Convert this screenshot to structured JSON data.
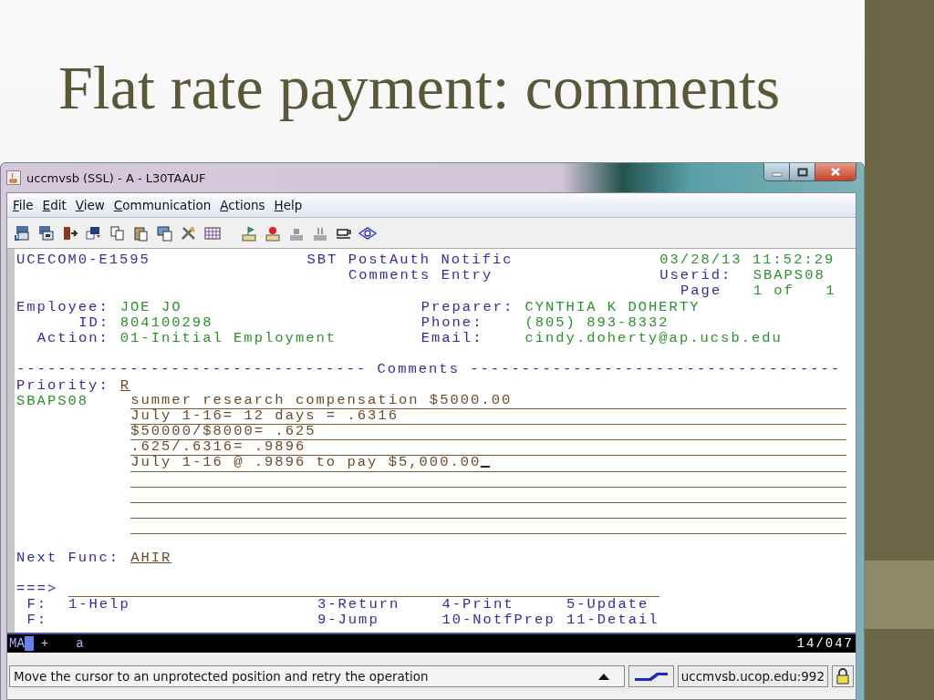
{
  "slide": {
    "title": "Flat rate payment: comments"
  },
  "window": {
    "title": "uccmvsb (SSL) - A - L30TAAUF"
  },
  "menu": [
    "File",
    "Edit",
    "View",
    "Communication",
    "Actions",
    "Help"
  ],
  "header": {
    "screen_id": "UCECOM0-E1595",
    "title_lines": [
      "SBT PostAuth Notific",
      "Comments Entry"
    ],
    "timestamp": "03/28/13 11:52:29",
    "userid_label": "Userid:",
    "userid": "SBAPS08",
    "page_label": "Page",
    "page_of": "1 of",
    "page_total": "1"
  },
  "employee": [
    {
      "label": "Employee:",
      "value": "JOE JO"
    },
    {
      "label": "ID:",
      "value": "804100298"
    },
    {
      "label": "Action:",
      "value": "01-Initial Employment"
    }
  ],
  "preparer": [
    {
      "label": "Preparer:",
      "value": "CYNTHIA K DOHERTY"
    },
    {
      "label": "Phone:",
      "value": "(805) 893-8332"
    },
    {
      "label": "Email:",
      "value": "cindy.doherty@ap.ucsb.edu"
    }
  ],
  "comments_rule": "---------------------------------- Comments ------------------------------------",
  "priority": {
    "label": "Priority:",
    "value": "R"
  },
  "comments": {
    "author": "SBAPS08",
    "lines": [
      {
        "kind": "text",
        "text": "summer research compensation $5000.00",
        "cursor": false
      },
      {
        "kind": "text",
        "text": "July 1-16= 12 days = .6316",
        "cursor": false
      },
      {
        "kind": "text",
        "text": "$50000/$8000= .625",
        "cursor": false
      },
      {
        "kind": "text",
        "text": ".625/.6316= .9896",
        "cursor": false
      },
      {
        "kind": "text",
        "text": "July 1-16 @ .9896 to pay $5,000.00",
        "cursor": true
      },
      {
        "kind": "blank",
        "cursor": false
      },
      {
        "kind": "blank",
        "cursor": false
      },
      {
        "kind": "blank",
        "cursor": false
      },
      {
        "kind": "blank",
        "cursor": false
      }
    ]
  },
  "next_func": {
    "label": "Next Func:",
    "value": "AHIR"
  },
  "command": {
    "prompt": "===>"
  },
  "function_keys": [
    {
      "label": "F:",
      "keys": [
        "1-Help",
        "3-Return",
        "4-Print",
        "5-Update"
      ]
    },
    {
      "label": "F:",
      "keys": [
        "9-Jump",
        "10-NotfPrep",
        "11-Detail"
      ]
    }
  ],
  "oia": {
    "mode": "MA",
    "indicator": "+",
    "flag": "a",
    "cursor_pos": "14/047"
  },
  "status_bar": {
    "message": "Move the cursor to an unprotected position and retry the operation",
    "host": "uccmvsb.ucop.edu:992"
  }
}
